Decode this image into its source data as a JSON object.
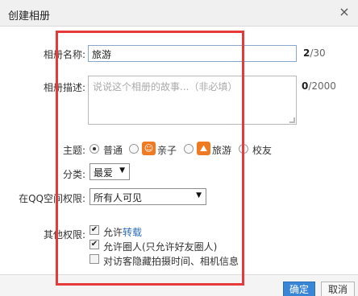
{
  "dialog": {
    "title": "创建相册",
    "close_glyph": "×"
  },
  "name": {
    "label": "相册名称:",
    "value": "旅游",
    "count": "2",
    "max": "/30"
  },
  "description": {
    "label": "相册描述:",
    "placeholder": "说说这个相册的故事...（非必填）",
    "count": "0",
    "max": "/2000"
  },
  "theme": {
    "label": "主题:",
    "options": [
      {
        "label": "普通",
        "selected": true
      },
      {
        "label": "亲子",
        "selected": false,
        "icon": "child-face-icon"
      },
      {
        "label": "旅游",
        "selected": false,
        "icon": "travel-icon"
      },
      {
        "label": "校友",
        "selected": false
      }
    ]
  },
  "category": {
    "label": "分类:",
    "value": "最爱",
    "arrow": "▼"
  },
  "qzone": {
    "label": "在QQ空间权限:",
    "value": "所有人可见",
    "arrow": "▼"
  },
  "other": {
    "label": "其他权限:",
    "options": [
      {
        "prefix": "允许",
        "link": "转载",
        "checked": true
      },
      {
        "prefix": "允许圈人(只允许好友圈人)",
        "link": "",
        "checked": true
      },
      {
        "prefix": "对访客隐藏拍摄时间、相机信息",
        "link": "",
        "checked": false
      }
    ]
  },
  "buttons": {
    "ok": "确定",
    "cancel": "取消"
  },
  "check_glyph": "✔",
  "colors": {
    "accent": "#3a86d6",
    "highlight": "#e6393a",
    "icon_orange": "#f07a22"
  }
}
